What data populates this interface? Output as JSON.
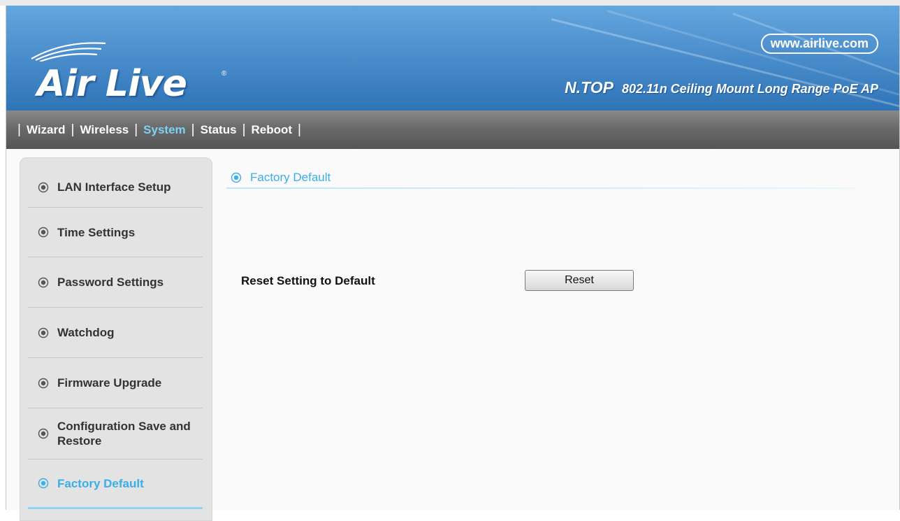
{
  "header": {
    "logo_text": "Air Live",
    "logo_registered": "®",
    "url": "www.airlive.com",
    "product_brand": "N.TOP",
    "product_description": "802.11n Ceiling Mount Long Range PoE AP",
    "colors": {
      "banner": "#4c8fcd",
      "text": "#ffffff"
    }
  },
  "nav": {
    "items": [
      {
        "label": "Wizard",
        "active": false
      },
      {
        "label": "Wireless",
        "active": false
      },
      {
        "label": "System",
        "active": true
      },
      {
        "label": "Status",
        "active": false
      },
      {
        "label": "Reboot",
        "active": false
      }
    ],
    "separator": "|",
    "active_color": "#7fd0f5"
  },
  "sidebar": {
    "items": [
      {
        "label": "LAN Interface Setup",
        "icon": "radio-bullet-icon"
      },
      {
        "label": "Time Settings",
        "icon": "radio-bullet-icon"
      },
      {
        "label": "Password Settings",
        "icon": "radio-bullet-icon"
      },
      {
        "label": "Watchdog",
        "icon": "radio-bullet-icon"
      },
      {
        "label": "Firmware Upgrade",
        "icon": "radio-bullet-icon"
      },
      {
        "label": "Configuration Save and Restore",
        "icon": "radio-bullet-icon"
      },
      {
        "label": "Factory Default",
        "icon": "radio-bullet-icon",
        "active": true
      }
    ],
    "active_color": "#3aaee6"
  },
  "main": {
    "title": "Factory Default",
    "reset_label": "Reset Setting to Default",
    "reset_button": "Reset"
  }
}
